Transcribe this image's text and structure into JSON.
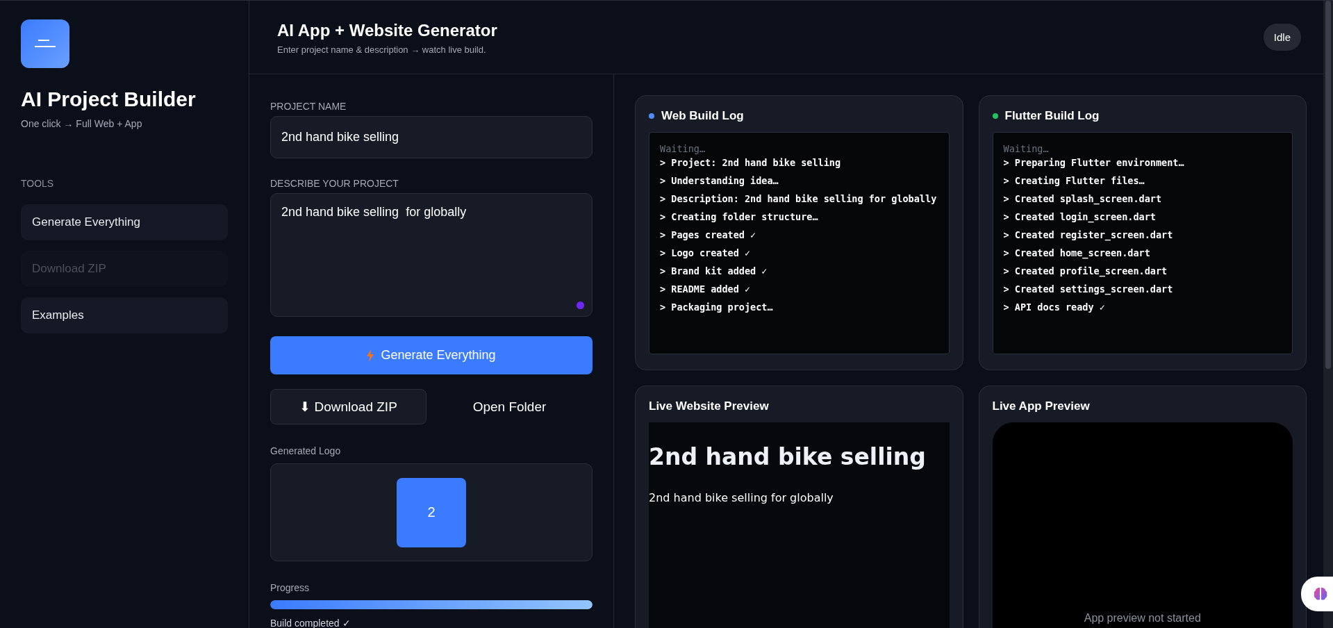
{
  "sidebar": {
    "title": "AI Project Builder",
    "subtitle": "One click → Full Web + App",
    "section": "TOOLS",
    "items": [
      {
        "label": "Generate Everything",
        "disabled": false
      },
      {
        "label": "Download ZIP",
        "disabled": true
      },
      {
        "label": "Examples",
        "disabled": false
      }
    ]
  },
  "header": {
    "title": "AI App + Website Generator",
    "subtitle": "Enter project name & description → watch live build.",
    "status": "Idle"
  },
  "form": {
    "name_label": "PROJECT NAME",
    "name_value": "2nd hand bike selling",
    "desc_label": "DESCRIBE YOUR PROJECT",
    "desc_value": "2nd hand bike selling  for globally",
    "generate_button": "Generate Everything",
    "download_button": "⬇ Download ZIP",
    "open_button": "Open Folder",
    "logo_label": "Generated Logo",
    "logo_letter": "2",
    "progress_label": "Progress",
    "progress": {
      "level": 1
    },
    "progress_status": "Build completed ✓"
  },
  "logs": [
    {
      "title": "Web Build Log",
      "color": "#4f8ef7",
      "lines": [
        {
          "kind": "muted",
          "text": "Waiting…"
        },
        {
          "kind": "line",
          "text": "> Project: 2nd hand bike selling"
        },
        {
          "kind": "line",
          "text": "> Understanding idea…"
        },
        {
          "kind": "line",
          "text": "> Description: 2nd hand bike selling for globally"
        },
        {
          "kind": "line",
          "text": "> Creating folder structure…"
        },
        {
          "kind": "line",
          "text": "> Pages created ✓"
        },
        {
          "kind": "line",
          "text": "> Logo created ✓"
        },
        {
          "kind": "line",
          "text": "> Brand kit added ✓"
        },
        {
          "kind": "line",
          "text": "> README added ✓"
        },
        {
          "kind": "line",
          "text": "> Packaging project…"
        }
      ]
    },
    {
      "title": "Flutter Build Log",
      "color": "#22c55e",
      "lines": [
        {
          "kind": "muted",
          "text": "Waiting…"
        },
        {
          "kind": "line",
          "text": "> Preparing Flutter environment…"
        },
        {
          "kind": "line",
          "text": "> Creating Flutter files…"
        },
        {
          "kind": "line",
          "text": "> Created splash_screen.dart"
        },
        {
          "kind": "line",
          "text": "> Created login_screen.dart"
        },
        {
          "kind": "line",
          "text": "> Created register_screen.dart"
        },
        {
          "kind": "line",
          "text": "> Created home_screen.dart"
        },
        {
          "kind": "line",
          "text": "> Created profile_screen.dart"
        },
        {
          "kind": "line",
          "text": "> Created settings_screen.dart"
        },
        {
          "kind": "line",
          "text": "> API docs ready ✓"
        }
      ]
    }
  ],
  "web_preview": {
    "title": "Live Website Preview",
    "heading": "2nd hand bike selling",
    "text": "2nd hand bike selling for globally"
  },
  "app_preview": {
    "title": "Live App Preview",
    "message": "App preview not started"
  }
}
